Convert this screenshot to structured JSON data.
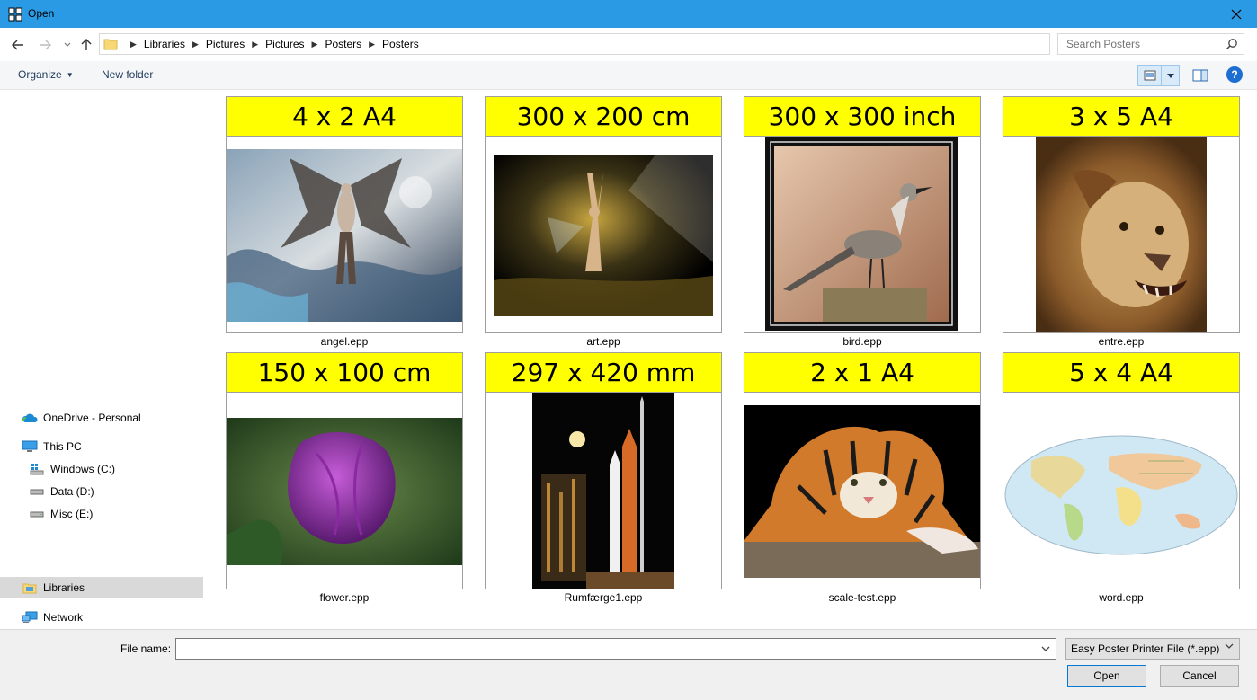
{
  "window": {
    "title": "Open"
  },
  "address": {
    "crumbs": [
      "Libraries",
      "Pictures",
      "Pictures",
      "Posters",
      "Posters"
    ]
  },
  "search": {
    "placeholder": "Search Posters"
  },
  "toolbar": {
    "organize_label": "Organize",
    "new_folder_label": "New folder",
    "help_label": "?"
  },
  "sidebar": {
    "items": [
      {
        "label": "OneDrive - Personal",
        "icon": "onedrive-icon"
      },
      {
        "label": "This PC",
        "icon": "computer-icon"
      },
      {
        "label": "Windows (C:)",
        "icon": "windows-drive-icon"
      },
      {
        "label": "Data (D:)",
        "icon": "drive-icon"
      },
      {
        "label": "Misc (E:)",
        "icon": "drive-icon"
      },
      {
        "label": "Libraries",
        "icon": "libraries-icon",
        "selected": true
      },
      {
        "label": "Network",
        "icon": "network-icon"
      }
    ]
  },
  "files": [
    {
      "size": "4 x 2 A4",
      "name": "angel.epp"
    },
    {
      "size": "300 x 200 cm",
      "name": "art.epp"
    },
    {
      "size": "300 x 300 inch",
      "name": "bird.epp"
    },
    {
      "size": "3 x 5 A4",
      "name": "entre.epp"
    },
    {
      "size": "150 x 100 cm",
      "name": "flower.epp"
    },
    {
      "size": "297 x 420 mm",
      "name": "Rumfærge1.epp"
    },
    {
      "size": "2 x 1 A4",
      "name": "scale-test.epp"
    },
    {
      "size": "5 x 4 A4",
      "name": "word.epp"
    }
  ],
  "footer": {
    "file_name_label": "File name:",
    "file_name_value": "",
    "filter_value": "Easy Poster Printer File (*.epp)",
    "open_label": "Open",
    "cancel_label": "Cancel"
  },
  "colors": {
    "titlebar": "#2b9ae4",
    "label_band": "#ffff00",
    "accent": "#0078d7"
  }
}
